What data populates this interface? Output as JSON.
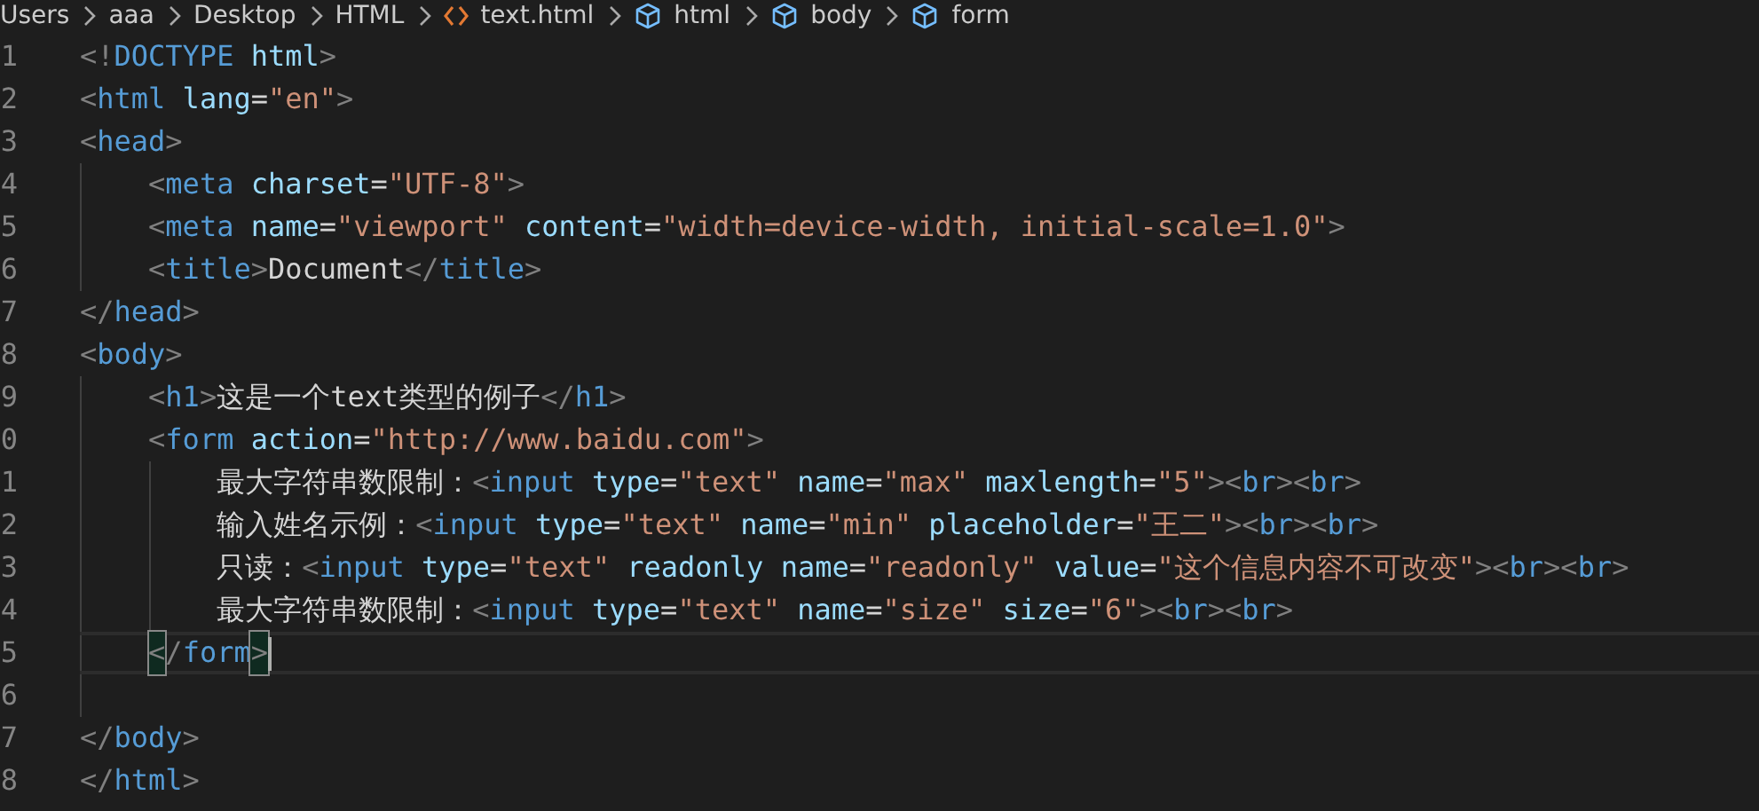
{
  "breadcrumbs": [
    {
      "kind": "folder",
      "label": "Users"
    },
    {
      "kind": "folder",
      "label": "aaa"
    },
    {
      "kind": "folder",
      "label": "Desktop"
    },
    {
      "kind": "folder",
      "label": "HTML"
    },
    {
      "kind": "file",
      "label": "text.html"
    },
    {
      "kind": "element",
      "label": "html"
    },
    {
      "kind": "element",
      "label": "body"
    },
    {
      "kind": "element",
      "label": "form"
    }
  ],
  "lines": [
    {
      "number": "1",
      "current": false,
      "bracket_match": false,
      "tokens": [
        {
          "kind": "punct",
          "text": "<!"
        },
        {
          "kind": "tag",
          "text": "DOCTYPE"
        },
        {
          "kind": "attr",
          "text": " html"
        },
        {
          "kind": "punct",
          "text": ">"
        }
      ]
    },
    {
      "number": "2",
      "current": false,
      "bracket_match": false,
      "tokens": [
        {
          "kind": "punct",
          "text": "<"
        },
        {
          "kind": "tag",
          "text": "html"
        },
        {
          "kind": "attr",
          "text": " lang"
        },
        {
          "kind": "text",
          "text": "="
        },
        {
          "kind": "string",
          "text": "\"en\""
        },
        {
          "kind": "punct",
          "text": ">"
        }
      ]
    },
    {
      "number": "3",
      "current": false,
      "bracket_match": false,
      "tokens": [
        {
          "kind": "punct",
          "text": "<"
        },
        {
          "kind": "tag",
          "text": "head"
        },
        {
          "kind": "punct",
          "text": ">"
        }
      ]
    },
    {
      "number": "4",
      "current": false,
      "bracket_match": false,
      "tokens": [
        {
          "kind": "punct",
          "text": "    <"
        },
        {
          "kind": "tag",
          "text": "meta"
        },
        {
          "kind": "attr",
          "text": " charset"
        },
        {
          "kind": "text",
          "text": "="
        },
        {
          "kind": "string",
          "text": "\"UTF-8\""
        },
        {
          "kind": "punct",
          "text": ">"
        }
      ]
    },
    {
      "number": "5",
      "current": false,
      "bracket_match": false,
      "tokens": [
        {
          "kind": "punct",
          "text": "    <"
        },
        {
          "kind": "tag",
          "text": "meta"
        },
        {
          "kind": "attr",
          "text": " name"
        },
        {
          "kind": "text",
          "text": "="
        },
        {
          "kind": "string",
          "text": "\"viewport\""
        },
        {
          "kind": "attr",
          "text": " content"
        },
        {
          "kind": "text",
          "text": "="
        },
        {
          "kind": "string",
          "text": "\"width=device-width, initial-scale=1.0\""
        },
        {
          "kind": "punct",
          "text": ">"
        }
      ]
    },
    {
      "number": "6",
      "current": false,
      "bracket_match": false,
      "tokens": [
        {
          "kind": "punct",
          "text": "    <"
        },
        {
          "kind": "tag",
          "text": "title"
        },
        {
          "kind": "punct",
          "text": ">"
        },
        {
          "kind": "text",
          "text": "Document"
        },
        {
          "kind": "punct",
          "text": "</"
        },
        {
          "kind": "tag",
          "text": "title"
        },
        {
          "kind": "punct",
          "text": ">"
        }
      ]
    },
    {
      "number": "7",
      "current": false,
      "bracket_match": false,
      "tokens": [
        {
          "kind": "punct",
          "text": "</"
        },
        {
          "kind": "tag",
          "text": "head"
        },
        {
          "kind": "punct",
          "text": ">"
        }
      ]
    },
    {
      "number": "8",
      "current": false,
      "bracket_match": false,
      "tokens": [
        {
          "kind": "punct",
          "text": "<"
        },
        {
          "kind": "tag",
          "text": "body"
        },
        {
          "kind": "punct",
          "text": ">"
        }
      ]
    },
    {
      "number": "9",
      "current": false,
      "bracket_match": false,
      "tokens": [
        {
          "kind": "punct",
          "text": "    <"
        },
        {
          "kind": "tag",
          "text": "h1"
        },
        {
          "kind": "punct",
          "text": ">"
        },
        {
          "kind": "text",
          "text": "这是一个text类型的例子"
        },
        {
          "kind": "punct",
          "text": "</"
        },
        {
          "kind": "tag",
          "text": "h1"
        },
        {
          "kind": "punct",
          "text": ">"
        }
      ]
    },
    {
      "number": "0",
      "current": false,
      "bracket_match": false,
      "tokens": [
        {
          "kind": "punct",
          "text": "    <"
        },
        {
          "kind": "tag",
          "text": "form"
        },
        {
          "kind": "attr",
          "text": " action"
        },
        {
          "kind": "text",
          "text": "="
        },
        {
          "kind": "string",
          "text": "\"http://www.baidu.com\""
        },
        {
          "kind": "punct",
          "text": ">"
        }
      ]
    },
    {
      "number": "1",
      "current": false,
      "bracket_match": false,
      "tokens": [
        {
          "kind": "text",
          "text": "        最大字符串数限制："
        },
        {
          "kind": "punct",
          "text": "<"
        },
        {
          "kind": "tag",
          "text": "input"
        },
        {
          "kind": "attr",
          "text": " type"
        },
        {
          "kind": "text",
          "text": "="
        },
        {
          "kind": "string",
          "text": "\"text\""
        },
        {
          "kind": "attr",
          "text": " name"
        },
        {
          "kind": "text",
          "text": "="
        },
        {
          "kind": "string",
          "text": "\"max\""
        },
        {
          "kind": "attr",
          "text": " maxlength"
        },
        {
          "kind": "text",
          "text": "="
        },
        {
          "kind": "string",
          "text": "\"5\""
        },
        {
          "kind": "punct",
          "text": "><"
        },
        {
          "kind": "tag",
          "text": "br"
        },
        {
          "kind": "punct",
          "text": "><"
        },
        {
          "kind": "tag",
          "text": "br"
        },
        {
          "kind": "punct",
          "text": ">"
        }
      ]
    },
    {
      "number": "2",
      "current": false,
      "bracket_match": false,
      "tokens": [
        {
          "kind": "text",
          "text": "        输入姓名示例："
        },
        {
          "kind": "punct",
          "text": "<"
        },
        {
          "kind": "tag",
          "text": "input"
        },
        {
          "kind": "attr",
          "text": " type"
        },
        {
          "kind": "text",
          "text": "="
        },
        {
          "kind": "string",
          "text": "\"text\""
        },
        {
          "kind": "attr",
          "text": " name"
        },
        {
          "kind": "text",
          "text": "="
        },
        {
          "kind": "string",
          "text": "\"min\""
        },
        {
          "kind": "attr",
          "text": " placeholder"
        },
        {
          "kind": "text",
          "text": "="
        },
        {
          "kind": "string",
          "text": "\"王二\""
        },
        {
          "kind": "punct",
          "text": "><"
        },
        {
          "kind": "tag",
          "text": "br"
        },
        {
          "kind": "punct",
          "text": "><"
        },
        {
          "kind": "tag",
          "text": "br"
        },
        {
          "kind": "punct",
          "text": ">"
        }
      ]
    },
    {
      "number": "3",
      "current": false,
      "bracket_match": false,
      "tokens": [
        {
          "kind": "text",
          "text": "        只读："
        },
        {
          "kind": "punct",
          "text": "<"
        },
        {
          "kind": "tag",
          "text": "input"
        },
        {
          "kind": "attr",
          "text": " type"
        },
        {
          "kind": "text",
          "text": "="
        },
        {
          "kind": "string",
          "text": "\"text\""
        },
        {
          "kind": "attr",
          "text": " readonly name"
        },
        {
          "kind": "text",
          "text": "="
        },
        {
          "kind": "string",
          "text": "\"readonly\""
        },
        {
          "kind": "attr",
          "text": " value"
        },
        {
          "kind": "text",
          "text": "="
        },
        {
          "kind": "string",
          "text": "\"这个信息内容不可改变\""
        },
        {
          "kind": "punct",
          "text": "><"
        },
        {
          "kind": "tag",
          "text": "br"
        },
        {
          "kind": "punct",
          "text": "><"
        },
        {
          "kind": "tag",
          "text": "br"
        },
        {
          "kind": "punct",
          "text": ">"
        }
      ]
    },
    {
      "number": "4",
      "current": false,
      "bracket_match": false,
      "tokens": [
        {
          "kind": "text",
          "text": "        最大字符串数限制："
        },
        {
          "kind": "punct",
          "text": "<"
        },
        {
          "kind": "tag",
          "text": "input"
        },
        {
          "kind": "attr",
          "text": " type"
        },
        {
          "kind": "text",
          "text": "="
        },
        {
          "kind": "string",
          "text": "\"text\""
        },
        {
          "kind": "attr",
          "text": " name"
        },
        {
          "kind": "text",
          "text": "="
        },
        {
          "kind": "string",
          "text": "\"size\""
        },
        {
          "kind": "attr",
          "text": " size"
        },
        {
          "kind": "text",
          "text": "="
        },
        {
          "kind": "string",
          "text": "\"6\""
        },
        {
          "kind": "punct",
          "text": "><"
        },
        {
          "kind": "tag",
          "text": "br"
        },
        {
          "kind": "punct",
          "text": "><"
        },
        {
          "kind": "tag",
          "text": "br"
        },
        {
          "kind": "punct",
          "text": ">"
        }
      ]
    },
    {
      "number": "5",
      "current": true,
      "bracket_match": true,
      "tokens": [
        {
          "kind": "punct",
          "text": "    <"
        },
        {
          "kind": "punct",
          "text": "/"
        },
        {
          "kind": "tag",
          "text": "form"
        },
        {
          "kind": "punct",
          "text": ">"
        }
      ]
    },
    {
      "number": "6",
      "current": false,
      "bracket_match": false
    },
    {
      "number": "7",
      "current": false,
      "bracket_match": false,
      "tokens": [
        {
          "kind": "punct",
          "text": "</"
        },
        {
          "kind": "tag",
          "text": "body"
        },
        {
          "kind": "punct",
          "text": ">"
        }
      ]
    },
    {
      "number": "8",
      "current": false,
      "bracket_match": false,
      "tokens": [
        {
          "kind": "punct",
          "text": "</"
        },
        {
          "kind": "tag",
          "text": "html"
        },
        {
          "kind": "punct",
          "text": ">"
        }
      ]
    }
  ]
}
